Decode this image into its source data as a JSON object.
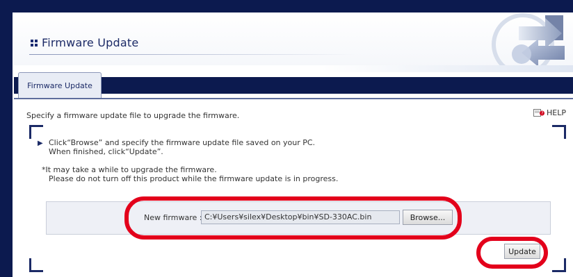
{
  "colors": {
    "frame": "#0c1a4f",
    "title": "#1b2a66",
    "highlight": "#e3001b",
    "panel_bg": "#eef0f6"
  },
  "header": {
    "title": "Firmware Update",
    "title_icon": "four-squares-icon",
    "logo_icon": "arrows-logo-graphic"
  },
  "tabs": [
    {
      "label": "Firmware Update",
      "active": true
    }
  ],
  "help": {
    "label": "HELP",
    "icon": "help-book-icon"
  },
  "instruction": "Specify a firmware update file to upgrade the firmware.",
  "steps": {
    "bullet_icon": "triangle-right-icon",
    "bullet_glyph": "▶",
    "line1": "Click“Browse” and specify the firmware update file saved on your PC.",
    "line2": "When finished, click“Update”.",
    "note1": "*It may take a while to upgrade the firmware.",
    "note2": "Please do not turn off this product while the firmware update is in progress."
  },
  "form": {
    "label": "New firmware :",
    "file_value": "C:¥Users¥silex¥Desktop¥bin¥SD-330AC.bin",
    "browse_label": "Browse...",
    "update_label": "Update"
  }
}
